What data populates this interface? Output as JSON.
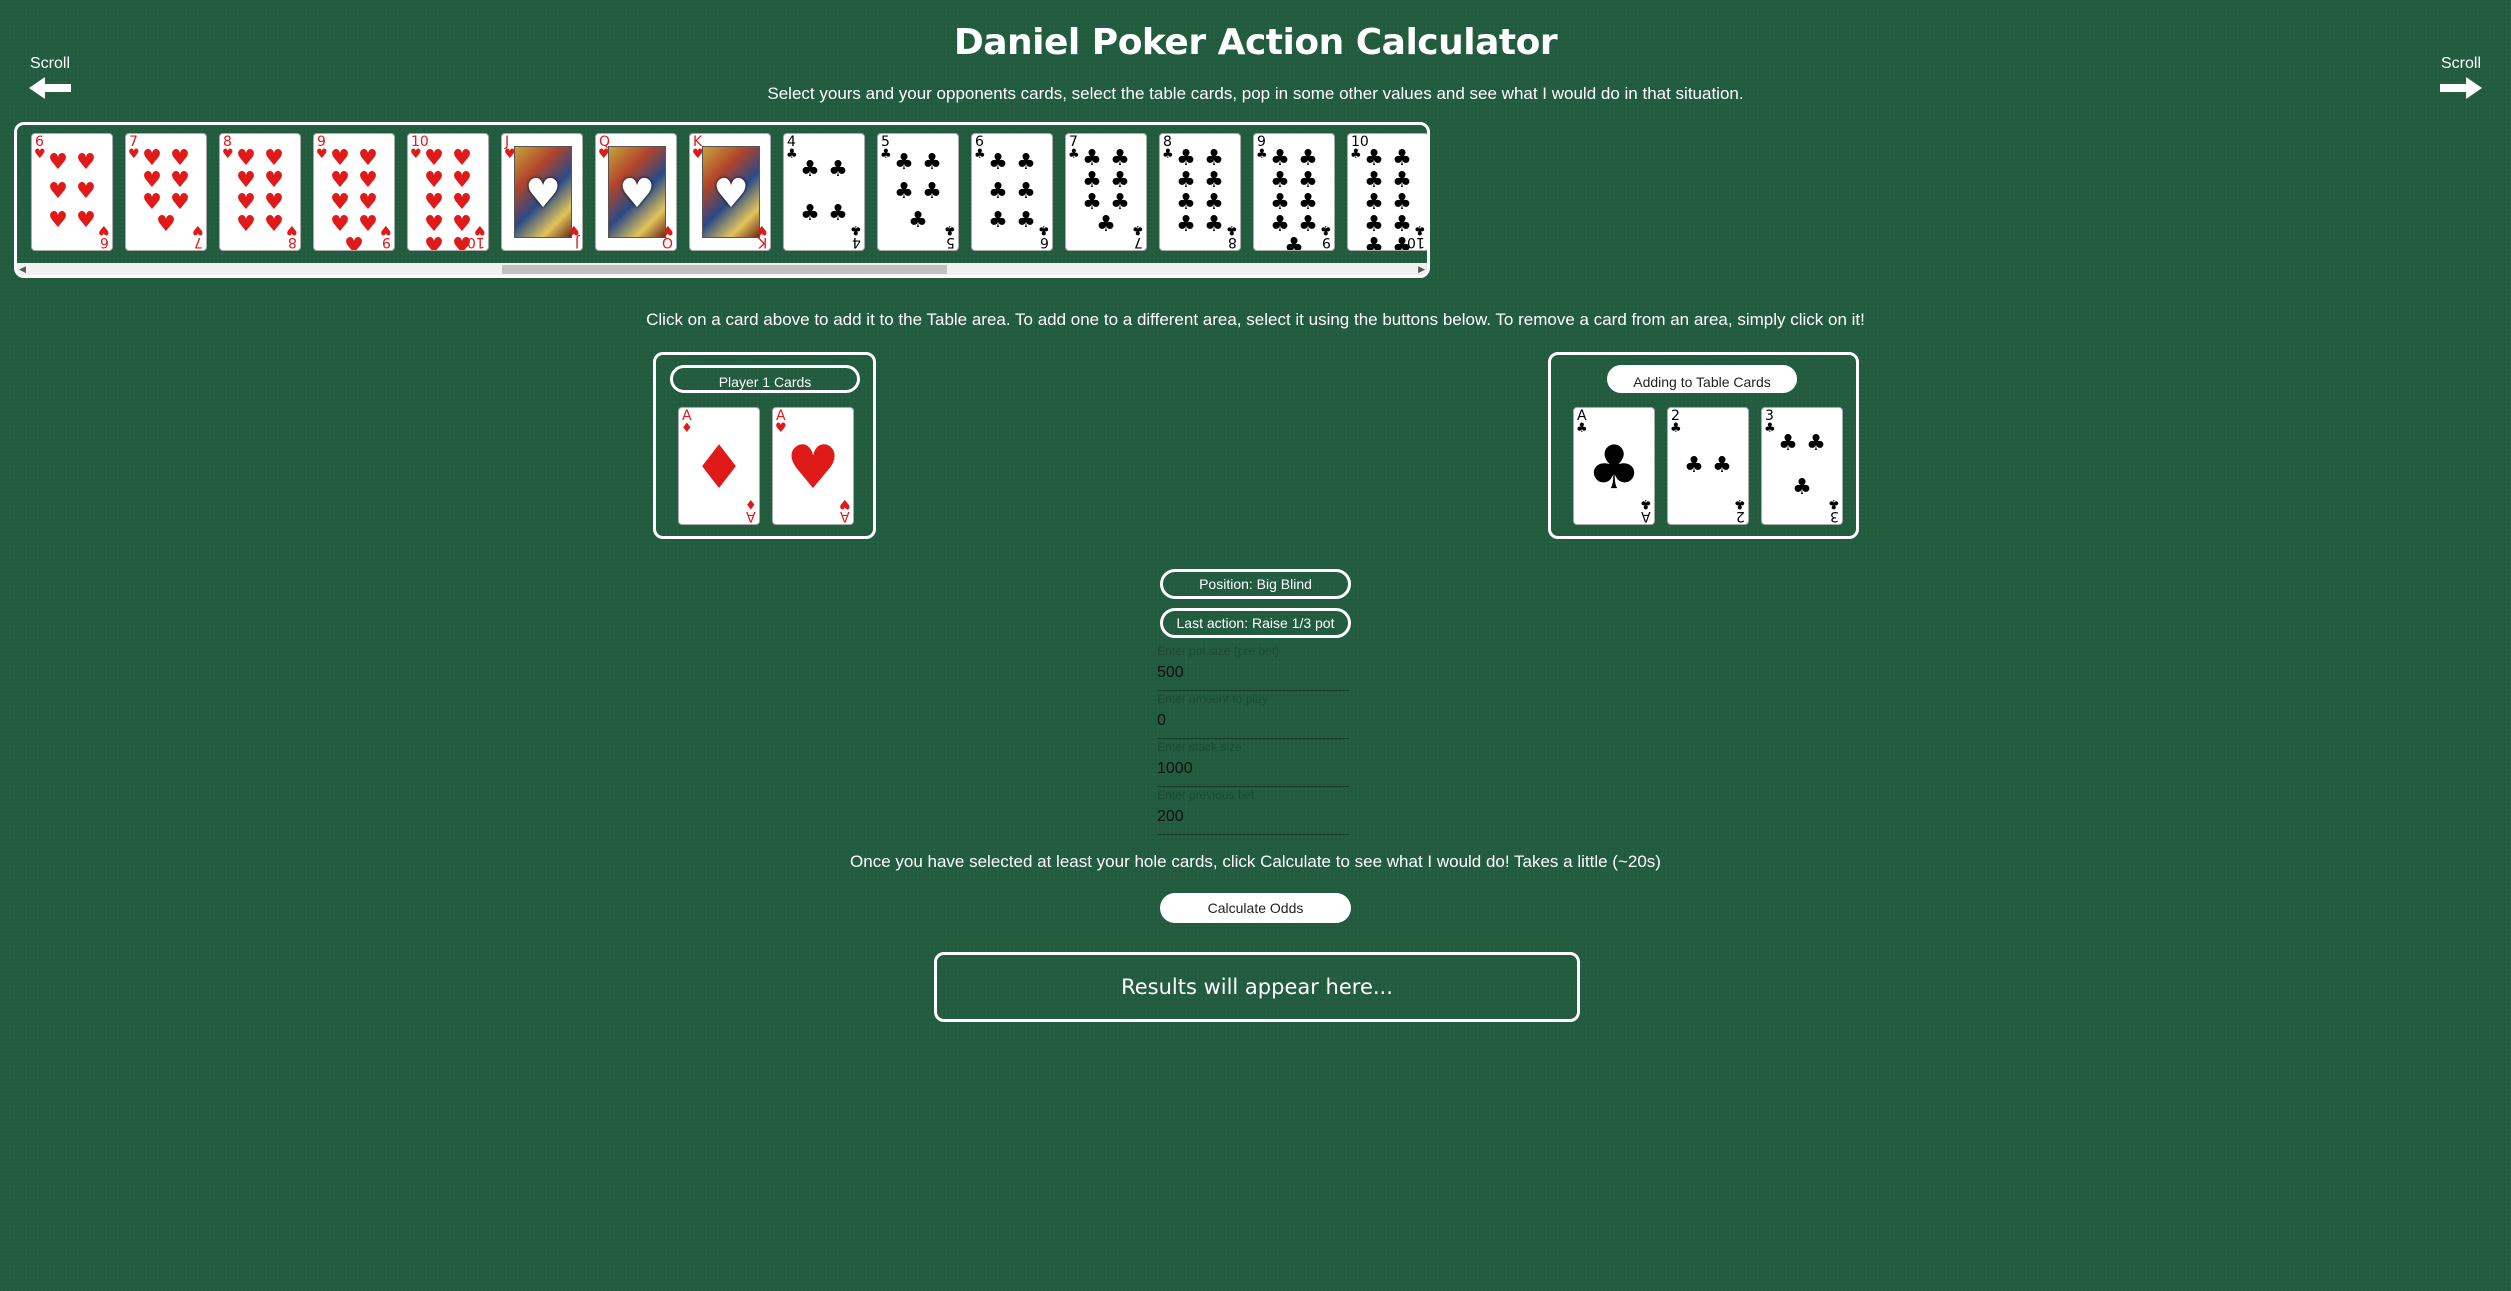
{
  "header": {
    "title": "Daniel Poker Action Calculator",
    "subtitle": "Select yours and your opponents cards, select the table cards, pop in some other values and see what I would do in that situation."
  },
  "scroll": {
    "left_label": "Scroll",
    "right_label": "Scroll"
  },
  "deck_strip": {
    "cards": [
      {
        "rank": "6",
        "suit": "♥",
        "color": "red",
        "pips": 6
      },
      {
        "rank": "7",
        "suit": "♥",
        "color": "red",
        "pips": 7
      },
      {
        "rank": "8",
        "suit": "♥",
        "color": "red",
        "pips": 8
      },
      {
        "rank": "9",
        "suit": "♥",
        "color": "red",
        "pips": 9
      },
      {
        "rank": "10",
        "suit": "♥",
        "color": "red",
        "pips": 10
      },
      {
        "rank": "J",
        "suit": "♥",
        "color": "red",
        "face": true
      },
      {
        "rank": "Q",
        "suit": "♥",
        "color": "red",
        "face": true
      },
      {
        "rank": "K",
        "suit": "♥",
        "color": "red",
        "face": true
      },
      {
        "rank": "4",
        "suit": "♣",
        "color": "blk",
        "pips": 4
      },
      {
        "rank": "5",
        "suit": "♣",
        "color": "blk",
        "pips": 5
      },
      {
        "rank": "6",
        "suit": "♣",
        "color": "blk",
        "pips": 6
      },
      {
        "rank": "7",
        "suit": "♣",
        "color": "blk",
        "pips": 7
      },
      {
        "rank": "8",
        "suit": "♣",
        "color": "blk",
        "pips": 8
      },
      {
        "rank": "9",
        "suit": "♣",
        "color": "blk",
        "pips": 9
      },
      {
        "rank": "10",
        "suit": "♣",
        "color": "blk",
        "pips": 10
      }
    ]
  },
  "instructions": "Click on a card above to add it to the Table area. To add one to a different area, select it using the buttons below. To remove a card from an area, simply click on it!",
  "player_area": {
    "button_label": "Player 1 Cards",
    "cards": [
      {
        "rank": "A",
        "suit": "♦",
        "color": "red",
        "ace": true
      },
      {
        "rank": "A",
        "suit": "♥",
        "color": "red",
        "ace": true
      }
    ]
  },
  "table_area": {
    "button_label": "Adding to Table Cards",
    "cards": [
      {
        "rank": "A",
        "suit": "♣",
        "color": "blk",
        "ace": true
      },
      {
        "rank": "2",
        "suit": "♣",
        "color": "blk",
        "pips": 2
      },
      {
        "rank": "3",
        "suit": "♣",
        "color": "blk",
        "pips": 3
      }
    ]
  },
  "controls": {
    "position_label": "Position: Big Blind",
    "last_action_label": "Last action: Raise 1/3 pot",
    "pot": {
      "placeholder": "Enter pot size (pre bet)",
      "value": "500"
    },
    "play": {
      "placeholder": "Enter amount to play",
      "value": "0"
    },
    "stack": {
      "placeholder": "Enter stack size",
      "value": "1000"
    },
    "prev": {
      "placeholder": "Enter previous bet",
      "value": "200"
    }
  },
  "calc_note": "Once you have selected at least your hole cards, click Calculate to see what I would do! Takes a little (~20s)",
  "calc_button": "Calculate Odds",
  "results": "Results will appear here..."
}
